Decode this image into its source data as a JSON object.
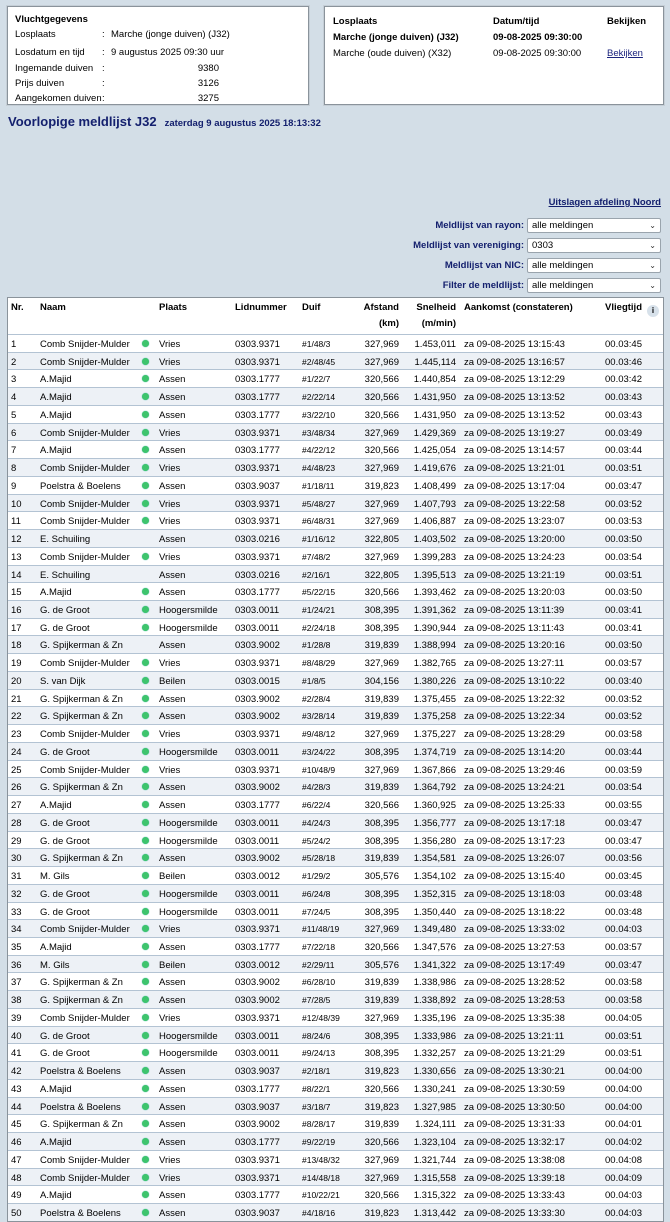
{
  "flight": {
    "title": "Vluchtgegevens",
    "rows": [
      {
        "label": "Losplaats",
        "value": "Marche (jonge duiven) (J32)"
      },
      {
        "label": "Losdatum en tijd",
        "value": "9 augustus 2025 09:30 uur"
      },
      {
        "label": "Ingemande duiven",
        "value": "9380"
      },
      {
        "label": "Prijs duiven",
        "value": "3126"
      },
      {
        "label": "Aangekomen duiven",
        "value": "3275"
      }
    ],
    "sep": ":"
  },
  "releases": {
    "headers": {
      "losplaats": "Losplaats",
      "datum": "Datum/tijd",
      "bekijken": "Bekijken"
    },
    "rows": [
      {
        "losplaats": "Marche (jonge duiven) (J32)",
        "datum": "09-08-2025 09:30:00",
        "link": ""
      },
      {
        "losplaats": "Marche (oude duiven) (X32)",
        "datum": "09-08-2025 09:30:00",
        "link": "Bekijken"
      }
    ]
  },
  "page": {
    "title": "Voorlopige meldlijst J32",
    "timestamp": "zaterdag 9 augustus 2025 18:13:32",
    "noord_link": "Uitslagen afdeling Noord"
  },
  "filters": [
    {
      "label": "Meldlijst van rayon:",
      "value": "alle meldingen"
    },
    {
      "label": "Meldlijst van vereniging:",
      "value": "0303"
    },
    {
      "label": "Meldlijst van NIC:",
      "value": "alle meldingen"
    },
    {
      "label": "Filter de meldlijst:",
      "value": "alle meldingen"
    }
  ],
  "table": {
    "headers": {
      "nr": "Nr.",
      "naam": "Naam",
      "plaats": "Plaats",
      "lid": "Lidnummer",
      "duif": "Duif",
      "afst": "Afstand",
      "afst_unit": "(km)",
      "snel": "Snelheid",
      "snel_unit": "(m/min)",
      "aank": "Aankomst (constateren)",
      "vlieg": "Vliegtijd",
      "info": "i"
    },
    "status_color": "#3ec46d",
    "rows": [
      [
        "1",
        "Comb Snijder-Mulder",
        true,
        "Vries",
        "0303.9371",
        "#1/48/3",
        "327,969",
        "1.453,011",
        "za 09-08-2025 13:15:43",
        "00.03:45"
      ],
      [
        "2",
        "Comb Snijder-Mulder",
        true,
        "Vries",
        "0303.9371",
        "#2/48/45",
        "327,969",
        "1.445,114",
        "za 09-08-2025 13:16:57",
        "00.03:46"
      ],
      [
        "3",
        "A.Majid",
        true,
        "Assen",
        "0303.1777",
        "#1/22/7",
        "320,566",
        "1.440,854",
        "za 09-08-2025 13:12:29",
        "00.03:42"
      ],
      [
        "4",
        "A.Majid",
        true,
        "Assen",
        "0303.1777",
        "#2/22/14",
        "320,566",
        "1.431,950",
        "za 09-08-2025 13:13:52",
        "00.03:43"
      ],
      [
        "5",
        "A.Majid",
        true,
        "Assen",
        "0303.1777",
        "#3/22/10",
        "320,566",
        "1.431,950",
        "za 09-08-2025 13:13:52",
        "00.03:43"
      ],
      [
        "6",
        "Comb Snijder-Mulder",
        true,
        "Vries",
        "0303.9371",
        "#3/48/34",
        "327,969",
        "1.429,369",
        "za 09-08-2025 13:19:27",
        "00.03:49"
      ],
      [
        "7",
        "A.Majid",
        true,
        "Assen",
        "0303.1777",
        "#4/22/12",
        "320,566",
        "1.425,054",
        "za 09-08-2025 13:14:57",
        "00.03:44"
      ],
      [
        "8",
        "Comb Snijder-Mulder",
        true,
        "Vries",
        "0303.9371",
        "#4/48/23",
        "327,969",
        "1.419,676",
        "za 09-08-2025 13:21:01",
        "00.03:51"
      ],
      [
        "9",
        "Poelstra & Boelens",
        true,
        "Assen",
        "0303.9037",
        "#1/18/11",
        "319,823",
        "1.408,499",
        "za 09-08-2025 13:17:04",
        "00.03:47"
      ],
      [
        "10",
        "Comb Snijder-Mulder",
        true,
        "Vries",
        "0303.9371",
        "#5/48/27",
        "327,969",
        "1.407,793",
        "za 09-08-2025 13:22:58",
        "00.03:52"
      ],
      [
        "11",
        "Comb Snijder-Mulder",
        true,
        "Vries",
        "0303.9371",
        "#6/48/31",
        "327,969",
        "1.406,887",
        "za 09-08-2025 13:23:07",
        "00.03:53"
      ],
      [
        "12",
        "E. Schuiling",
        false,
        "Assen",
        "0303.0216",
        "#1/16/12",
        "322,805",
        "1.403,502",
        "za 09-08-2025 13:20:00",
        "00.03:50"
      ],
      [
        "13",
        "Comb Snijder-Mulder",
        true,
        "Vries",
        "0303.9371",
        "#7/48/2",
        "327,969",
        "1.399,283",
        "za 09-08-2025 13:24:23",
        "00.03:54"
      ],
      [
        "14",
        "E. Schuiling",
        false,
        "Assen",
        "0303.0216",
        "#2/16/1",
        "322,805",
        "1.395,513",
        "za 09-08-2025 13:21:19",
        "00.03:51"
      ],
      [
        "15",
        "A.Majid",
        true,
        "Assen",
        "0303.1777",
        "#5/22/15",
        "320,566",
        "1.393,462",
        "za 09-08-2025 13:20:03",
        "00.03:50"
      ],
      [
        "16",
        "G. de Groot",
        true,
        "Hoogersmilde",
        "0303.0011",
        "#1/24/21",
        "308,395",
        "1.391,362",
        "za 09-08-2025 13:11:39",
        "00.03:41"
      ],
      [
        "17",
        "G. de Groot",
        true,
        "Hoogersmilde",
        "0303.0011",
        "#2/24/18",
        "308,395",
        "1.390,944",
        "za 09-08-2025 13:11:43",
        "00.03:41"
      ],
      [
        "18",
        "G. Spijkerman & Zn",
        false,
        "Assen",
        "0303.9002",
        "#1/28/8",
        "319,839",
        "1.388,994",
        "za 09-08-2025 13:20:16",
        "00.03:50"
      ],
      [
        "19",
        "Comb Snijder-Mulder",
        true,
        "Vries",
        "0303.9371",
        "#8/48/29",
        "327,969",
        "1.382,765",
        "za 09-08-2025 13:27:11",
        "00.03:57"
      ],
      [
        "20",
        "S. van Dijk",
        true,
        "Beilen",
        "0303.0015",
        "#1/8/5",
        "304,156",
        "1.380,226",
        "za 09-08-2025 13:10:22",
        "00.03:40"
      ],
      [
        "21",
        "G. Spijkerman & Zn",
        true,
        "Assen",
        "0303.9002",
        "#2/28/4",
        "319,839",
        "1.375,455",
        "za 09-08-2025 13:22:32",
        "00.03:52"
      ],
      [
        "22",
        "G. Spijkerman & Zn",
        true,
        "Assen",
        "0303.9002",
        "#3/28/14",
        "319,839",
        "1.375,258",
        "za 09-08-2025 13:22:34",
        "00.03:52"
      ],
      [
        "23",
        "Comb Snijder-Mulder",
        true,
        "Vries",
        "0303.9371",
        "#9/48/12",
        "327,969",
        "1.375,227",
        "za 09-08-2025 13:28:29",
        "00.03:58"
      ],
      [
        "24",
        "G. de Groot",
        true,
        "Hoogersmilde",
        "0303.0011",
        "#3/24/22",
        "308,395",
        "1.374,719",
        "za 09-08-2025 13:14:20",
        "00.03:44"
      ],
      [
        "25",
        "Comb Snijder-Mulder",
        true,
        "Vries",
        "0303.9371",
        "#10/48/9",
        "327,969",
        "1.367,866",
        "za 09-08-2025 13:29:46",
        "00.03:59"
      ],
      [
        "26",
        "G. Spijkerman & Zn",
        true,
        "Assen",
        "0303.9002",
        "#4/28/3",
        "319,839",
        "1.364,792",
        "za 09-08-2025 13:24:21",
        "00.03:54"
      ],
      [
        "27",
        "A.Majid",
        true,
        "Assen",
        "0303.1777",
        "#6/22/4",
        "320,566",
        "1.360,925",
        "za 09-08-2025 13:25:33",
        "00.03:55"
      ],
      [
        "28",
        "G. de Groot",
        true,
        "Hoogersmilde",
        "0303.0011",
        "#4/24/3",
        "308,395",
        "1.356,777",
        "za 09-08-2025 13:17:18",
        "00.03:47"
      ],
      [
        "29",
        "G. de Groot",
        true,
        "Hoogersmilde",
        "0303.0011",
        "#5/24/2",
        "308,395",
        "1.356,280",
        "za 09-08-2025 13:17:23",
        "00.03:47"
      ],
      [
        "30",
        "G. Spijkerman & Zn",
        true,
        "Assen",
        "0303.9002",
        "#5/28/18",
        "319,839",
        "1.354,581",
        "za 09-08-2025 13:26:07",
        "00.03:56"
      ],
      [
        "31",
        "M. Gils",
        true,
        "Beilen",
        "0303.0012",
        "#1/29/2",
        "305,576",
        "1.354,102",
        "za 09-08-2025 13:15:40",
        "00.03:45"
      ],
      [
        "32",
        "G. de Groot",
        true,
        "Hoogersmilde",
        "0303.0011",
        "#6/24/8",
        "308,395",
        "1.352,315",
        "za 09-08-2025 13:18:03",
        "00.03:48"
      ],
      [
        "33",
        "G. de Groot",
        true,
        "Hoogersmilde",
        "0303.0011",
        "#7/24/5",
        "308,395",
        "1.350,440",
        "za 09-08-2025 13:18:22",
        "00.03:48"
      ],
      [
        "34",
        "Comb Snijder-Mulder",
        true,
        "Vries",
        "0303.9371",
        "#11/48/19",
        "327,969",
        "1.349,480",
        "za 09-08-2025 13:33:02",
        "00.04:03"
      ],
      [
        "35",
        "A.Majid",
        true,
        "Assen",
        "0303.1777",
        "#7/22/18",
        "320,566",
        "1.347,576",
        "za 09-08-2025 13:27:53",
        "00.03:57"
      ],
      [
        "36",
        "M. Gils",
        true,
        "Beilen",
        "0303.0012",
        "#2/29/11",
        "305,576",
        "1.341,322",
        "za 09-08-2025 13:17:49",
        "00.03:47"
      ],
      [
        "37",
        "G. Spijkerman & Zn",
        true,
        "Assen",
        "0303.9002",
        "#6/28/10",
        "319,839",
        "1.338,986",
        "za 09-08-2025 13:28:52",
        "00.03:58"
      ],
      [
        "38",
        "G. Spijkerman & Zn",
        true,
        "Assen",
        "0303.9002",
        "#7/28/5",
        "319,839",
        "1.338,892",
        "za 09-08-2025 13:28:53",
        "00.03:58"
      ],
      [
        "39",
        "Comb Snijder-Mulder",
        true,
        "Vries",
        "0303.9371",
        "#12/48/39",
        "327,969",
        "1.335,196",
        "za 09-08-2025 13:35:38",
        "00.04:05"
      ],
      [
        "40",
        "G. de Groot",
        true,
        "Hoogersmilde",
        "0303.0011",
        "#8/24/6",
        "308,395",
        "1.333,986",
        "za 09-08-2025 13:21:11",
        "00.03:51"
      ],
      [
        "41",
        "G. de Groot",
        true,
        "Hoogersmilde",
        "0303.0011",
        "#9/24/13",
        "308,395",
        "1.332,257",
        "za 09-08-2025 13:21:29",
        "00.03:51"
      ],
      [
        "42",
        "Poelstra & Boelens",
        true,
        "Assen",
        "0303.9037",
        "#2/18/1",
        "319,823",
        "1.330,656",
        "za 09-08-2025 13:30:21",
        "00.04:00"
      ],
      [
        "43",
        "A.Majid",
        true,
        "Assen",
        "0303.1777",
        "#8/22/1",
        "320,566",
        "1.330,241",
        "za 09-08-2025 13:30:59",
        "00.04:00"
      ],
      [
        "44",
        "Poelstra & Boelens",
        true,
        "Assen",
        "0303.9037",
        "#3/18/7",
        "319,823",
        "1.327,985",
        "za 09-08-2025 13:30:50",
        "00.04:00"
      ],
      [
        "45",
        "G. Spijkerman & Zn",
        true,
        "Assen",
        "0303.9002",
        "#8/28/17",
        "319,839",
        "1.324,111",
        "za 09-08-2025 13:31:33",
        "00.04:01"
      ],
      [
        "46",
        "A.Majid",
        true,
        "Assen",
        "0303.1777",
        "#9/22/19",
        "320,566",
        "1.323,104",
        "za 09-08-2025 13:32:17",
        "00.04:02"
      ],
      [
        "47",
        "Comb Snijder-Mulder",
        true,
        "Vries",
        "0303.9371",
        "#13/48/32",
        "327,969",
        "1.321,744",
        "za 09-08-2025 13:38:08",
        "00.04:08"
      ],
      [
        "48",
        "Comb Snijder-Mulder",
        true,
        "Vries",
        "0303.9371",
        "#14/48/18",
        "327,969",
        "1.315,558",
        "za 09-08-2025 13:39:18",
        "00.04:09"
      ],
      [
        "49",
        "A.Majid",
        true,
        "Assen",
        "0303.1777",
        "#10/22/21",
        "320,566",
        "1.315,322",
        "za 09-08-2025 13:33:43",
        "00.04:03"
      ],
      [
        "50",
        "Poelstra & Boelens",
        true,
        "Assen",
        "0303.9037",
        "#4/18/16",
        "319,823",
        "1.313,442",
        "za 09-08-2025 13:33:30",
        "00.04:03"
      ]
    ]
  }
}
